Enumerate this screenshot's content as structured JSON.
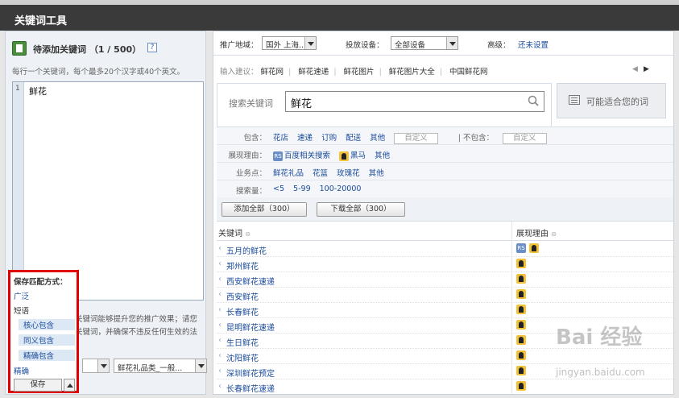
{
  "window": {
    "title": "关键词工具"
  },
  "left": {
    "header_title": "待添加关键词 （1 / 500）",
    "help_icon_text": "?",
    "hint": "每行一个关键词，每个最多20个汉字或40个英文。",
    "editor": {
      "line_number": "1",
      "text": "鲜花"
    },
    "note_line1": "关键词能够提升您的推广效果；请您",
    "note_line2": "关键词，并确保不违反任何生效的法",
    "select_category": "鲜花礼品类_一般..."
  },
  "match_popup": {
    "title": "保存匹配方式：",
    "options": [
      "广泛",
      "短语",
      "核心包含",
      "同义包含",
      "精确包含",
      "精确"
    ],
    "save_label": "保存"
  },
  "filters": {
    "region_label": "推广地域：",
    "region_value": "国外 上海...",
    "device_label": "投放设备：",
    "device_value": "全部设备",
    "advanced_label": "高级：",
    "advanced_link": "还未设置"
  },
  "suggestions": {
    "label": "输入建议：",
    "items": [
      "鲜花网",
      "鲜花速递",
      "鲜花图片",
      "鲜花图片大全",
      "中国鲜花网"
    ],
    "prev": "◀",
    "next": "▶"
  },
  "search": {
    "label": "搜索关键词",
    "value": "鲜花",
    "alt_tab_label": "可能适合您的词"
  },
  "filter_panel": {
    "include_label": "包含：",
    "include_items": [
      "花店",
      "速递",
      "订购",
      "配送",
      "其他"
    ],
    "custom_label": "自定义",
    "exclude_label": "| 不包含：",
    "exclude_custom": "自定义",
    "reason_label": "展现理由：",
    "reason_items": [
      "百度相关搜索",
      "黑马",
      "其他"
    ],
    "rs_icon_text": "RS",
    "business_label": "业务点：",
    "business_items": [
      "鲜花礼品",
      "花篮",
      "玫瑰花",
      "其他"
    ],
    "volume_label": "搜索量：",
    "volume_items": [
      "<5",
      "5-99",
      "100-20000"
    ]
  },
  "actions": {
    "add_all": "添加全部（300）",
    "download_all": "下载全部（300）"
  },
  "table": {
    "col_keyword": "关键词",
    "col_reason": "展现理由",
    "sort_icon": "⊖",
    "rows": [
      {
        "keyword": "五月的鲜花",
        "rs": true
      },
      {
        "keyword": "郑州鲜花",
        "rs": false
      },
      {
        "keyword": "西安鲜花速递",
        "rs": false
      },
      {
        "keyword": "西安鲜花",
        "rs": false
      },
      {
        "keyword": "长春鲜花",
        "rs": false
      },
      {
        "keyword": "昆明鲜花速递",
        "rs": false
      },
      {
        "keyword": "生日鲜花",
        "rs": false
      },
      {
        "keyword": "沈阳鲜花",
        "rs": false
      },
      {
        "keyword": "深圳鲜花预定",
        "rs": false
      },
      {
        "keyword": "长春鲜花速递",
        "rs": false
      }
    ]
  },
  "watermark": {
    "main": "Bai 经验",
    "sub": "jingyan.baidu.com"
  }
}
